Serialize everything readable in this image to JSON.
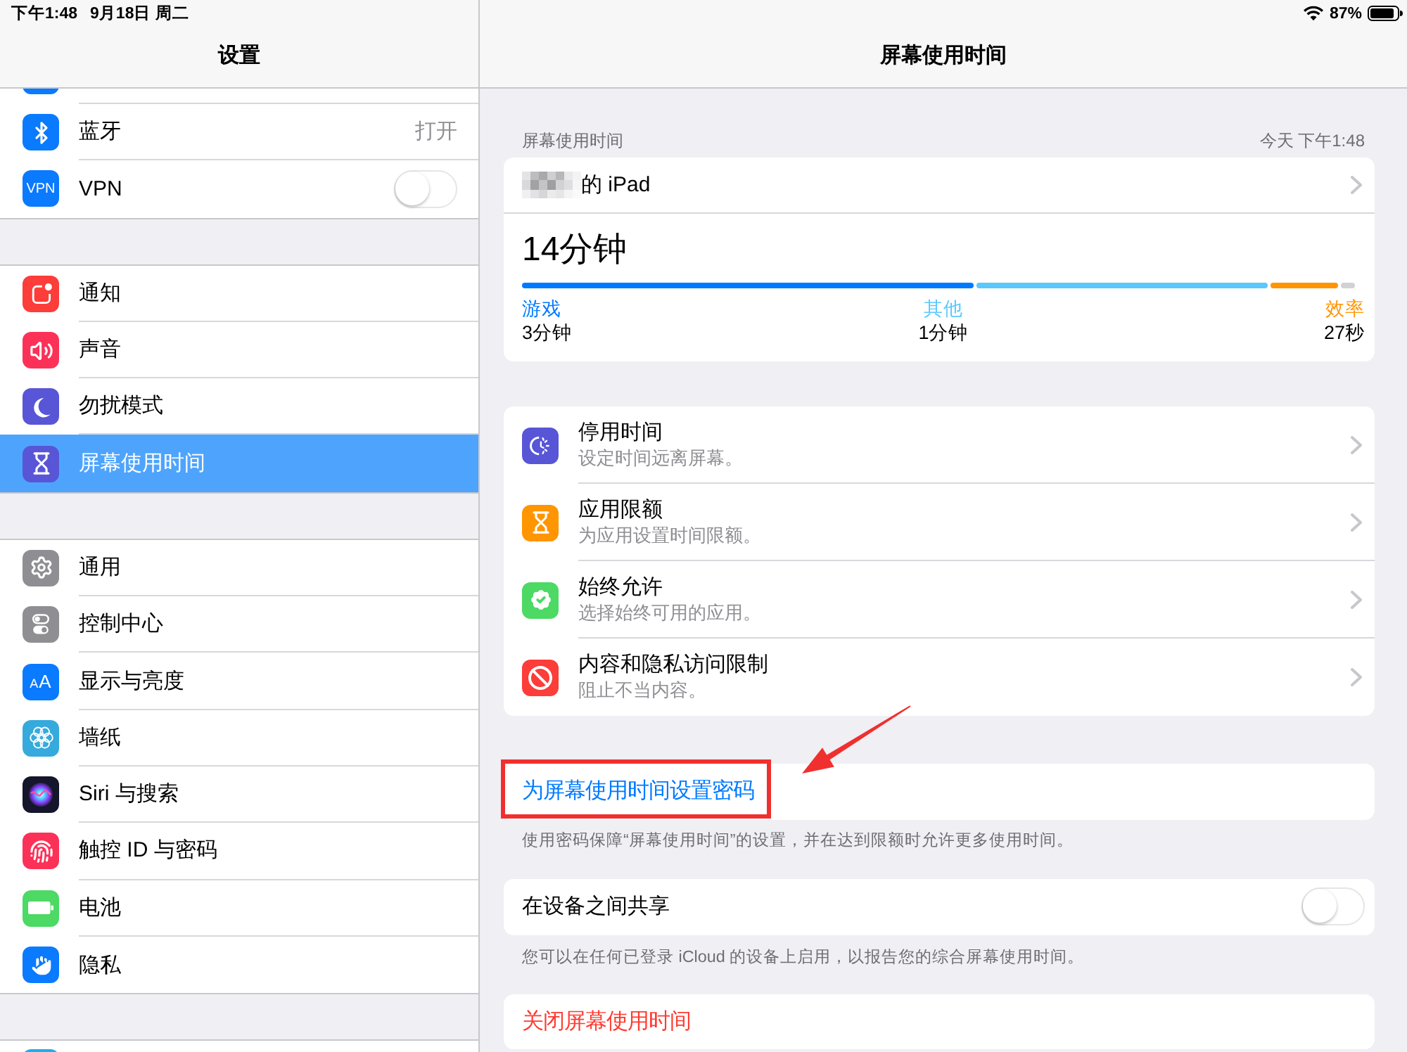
{
  "status_bar": {
    "time": "下午1:48",
    "date": "9月18日 周二",
    "battery": "87%"
  },
  "sidebar": {
    "title": "设置",
    "groups": [
      {
        "items": [
          {
            "label": "蓝牙",
            "kind": "value",
            "value": "打开",
            "selected": false
          },
          {
            "label": "VPN",
            "kind": "switch",
            "icon_text": "VPN",
            "on": false,
            "selected": false
          }
        ]
      },
      {
        "items": [
          {
            "label": "通知",
            "kind": "plain",
            "selected": false
          },
          {
            "label": "声音",
            "kind": "plain",
            "selected": false
          },
          {
            "label": "勿扰模式",
            "kind": "plain",
            "selected": false
          },
          {
            "label": "屏幕使用时间",
            "kind": "plain",
            "selected": true
          }
        ]
      },
      {
        "items": [
          {
            "label": "通用",
            "kind": "plain",
            "selected": false
          },
          {
            "label": "控制中心",
            "kind": "plain",
            "selected": false
          },
          {
            "label": "显示与亮度",
            "kind": "plain",
            "icon_text": "AA",
            "selected": false
          },
          {
            "label": "墙纸",
            "kind": "plain",
            "selected": false
          },
          {
            "label": "Siri 与搜索",
            "kind": "plain",
            "selected": false
          },
          {
            "label": "触控 ID 与密码",
            "kind": "plain",
            "selected": false
          },
          {
            "label": "电池",
            "kind": "plain",
            "selected": false
          },
          {
            "label": "隐私",
            "kind": "plain",
            "selected": false
          }
        ]
      }
    ]
  },
  "detail": {
    "title": "屏幕使用时间",
    "usage": {
      "header": "屏幕使用时间",
      "updated": "今天 下午1:48",
      "device": "的 iPad",
      "total": "14分钟",
      "categories": [
        {
          "name": "游戏",
          "time": "3分钟",
          "color": "#007aff"
        },
        {
          "name": "其他",
          "time": "1分钟",
          "color": "#5ac8fa"
        },
        {
          "name": "效率",
          "time": "27秒",
          "color": "#ff9500"
        }
      ]
    },
    "features": [
      {
        "title": "停用时间",
        "subtitle": "设定时间远离屏幕。"
      },
      {
        "title": "应用限额",
        "subtitle": "为应用设置时间限额。"
      },
      {
        "title": "始终允许",
        "subtitle": "选择始终可用的应用。"
      },
      {
        "title": "内容和隐私访问限制",
        "subtitle": "阻止不当内容。"
      }
    ],
    "passcode": {
      "label": "为屏幕使用时间设置密码",
      "highlighted": true,
      "footer": "使用密码保障“屏幕使用时间”的设置，并在达到限额时允许更多使用时间。"
    },
    "share": {
      "label": "在设备之间共享",
      "on": false,
      "footer": "您可以在任何已登录 iCloud 的设备上启用，以报告您的综合屏幕使用时间。"
    },
    "turn_off": {
      "label": "关闭屏幕使用时间"
    }
  }
}
